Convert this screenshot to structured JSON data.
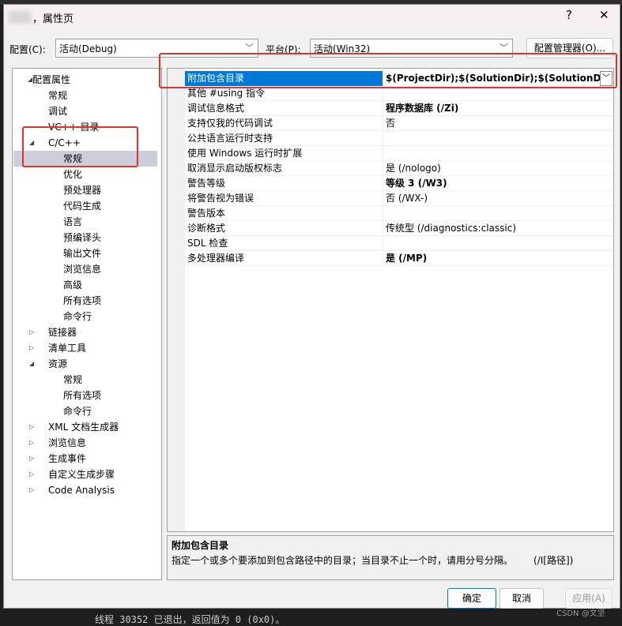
{
  "window": {
    "title": "，属性页",
    "help": "?",
    "close": "✕"
  },
  "toolbar": {
    "config_label": "配置(C):",
    "config_value": "活动(Debug)",
    "platform_label": "平台(P):",
    "platform_value": "活动(Win32)",
    "config_manager": "配置管理器(O)..."
  },
  "tree": {
    "items": [
      {
        "label": "配置属性",
        "level": 0,
        "expanded": true
      },
      {
        "label": "常规",
        "level": 1
      },
      {
        "label": "调试",
        "level": 1
      },
      {
        "label": "VC++ 目录",
        "level": 1
      },
      {
        "label": "C/C++",
        "level": 1,
        "expanded": true
      },
      {
        "label": "常规",
        "level": 2,
        "selected": true
      },
      {
        "label": "优化",
        "level": 2
      },
      {
        "label": "预处理器",
        "level": 2
      },
      {
        "label": "代码生成",
        "level": 2
      },
      {
        "label": "语言",
        "level": 2
      },
      {
        "label": "预编译头",
        "level": 2
      },
      {
        "label": "输出文件",
        "level": 2
      },
      {
        "label": "浏览信息",
        "level": 2
      },
      {
        "label": "高级",
        "level": 2
      },
      {
        "label": "所有选项",
        "level": 2
      },
      {
        "label": "命令行",
        "level": 2
      },
      {
        "label": "链接器",
        "level": 1,
        "expanded": false
      },
      {
        "label": "清单工具",
        "level": 1,
        "expanded": false
      },
      {
        "label": "资源",
        "level": 1,
        "expanded": true
      },
      {
        "label": "常规",
        "level": 2
      },
      {
        "label": "所有选项",
        "level": 2
      },
      {
        "label": "命令行",
        "level": 2
      },
      {
        "label": "XML 文档生成器",
        "level": 1,
        "expanded": false
      },
      {
        "label": "浏览信息",
        "level": 1,
        "expanded": false
      },
      {
        "label": "生成事件",
        "level": 1,
        "expanded": false
      },
      {
        "label": "自定义生成步骤",
        "level": 1,
        "expanded": false
      },
      {
        "label": "Code Analysis",
        "level": 1,
        "expanded": false
      }
    ]
  },
  "grid": {
    "rows": [
      {
        "name": "附加包含目录",
        "value": "$(ProjectDir);$(SolutionDir);$(SolutionDir)\\I",
        "bold": true,
        "selected": true
      },
      {
        "name": "其他 #using 指令",
        "value": ""
      },
      {
        "name": "调试信息格式",
        "value": "程序数据库 (/Zi)",
        "bold": true
      },
      {
        "name": "支持仅我的代码调试",
        "value": "否"
      },
      {
        "name": "公共语言运行时支持",
        "value": ""
      },
      {
        "name": "使用 Windows 运行时扩展",
        "value": ""
      },
      {
        "name": "取消显示启动版权标志",
        "value": "是 (/nologo)"
      },
      {
        "name": "警告等级",
        "value": "等级 3 (/W3)",
        "bold": true
      },
      {
        "name": "将警告视为错误",
        "value": "否 (/WX-)"
      },
      {
        "name": "警告版本",
        "value": ""
      },
      {
        "name": "诊断格式",
        "value": "传统型 (/diagnostics:classic)"
      },
      {
        "name": "SDL 检查",
        "value": ""
      },
      {
        "name": "多处理器编译",
        "value": "是 (/MP)",
        "bold": true
      }
    ]
  },
  "description": {
    "title": "附加包含目录",
    "text": "指定一个或多个要添加到包含路径中的目录；当目录不止一个时，请用分号分隔。",
    "switch": "(/I[路径])"
  },
  "buttons": {
    "ok": "确定",
    "cancel": "取消",
    "apply": "应用(A)"
  },
  "console": {
    "text": "线程 30352 已退出，返回值为 0 (0x0)。"
  },
  "watermark": "CSDN @文坚",
  "colors": {
    "selection": "#0078d7",
    "annotation": "#e8302a"
  }
}
